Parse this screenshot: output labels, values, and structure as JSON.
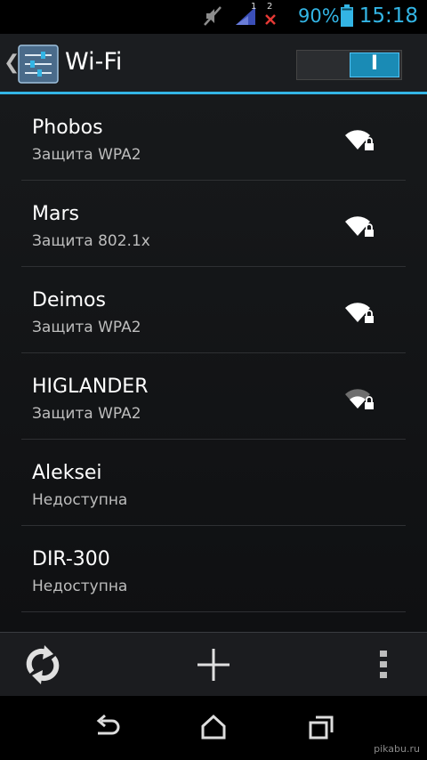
{
  "status_bar": {
    "icons": [
      "mute-icon",
      "signal-icon",
      "no-sim-icon",
      "battery-icon"
    ],
    "signal_badge": "1",
    "sim_badge": "2",
    "battery": "90%",
    "time": "15:18",
    "accent_color": "#33b5e5"
  },
  "action_bar": {
    "title": "Wi-Fi",
    "toggle_state": "on",
    "toggle_label": "I"
  },
  "networks": [
    {
      "name": "Phobos",
      "status": "Защита WPA2",
      "secured": true
    },
    {
      "name": "Mars",
      "status": "Защита 802.1x",
      "secured": true
    },
    {
      "name": "Deimos",
      "status": "Защита WPA2",
      "secured": true
    },
    {
      "name": "HIGLANDER",
      "status": "Защита WPA2",
      "secured": true
    },
    {
      "name": "Aleksei",
      "status": "Недоступна",
      "secured": false
    },
    {
      "name": "DIR-300",
      "status": "Недоступна",
      "secured": false
    }
  ],
  "bottom_bar": {
    "icons": [
      "refresh-icon",
      "add-network-icon",
      "overflow-menu-icon"
    ]
  },
  "nav_bar": {
    "icons": [
      "back-icon",
      "home-icon",
      "recents-icon"
    ]
  },
  "watermark": "pikabu.ru"
}
